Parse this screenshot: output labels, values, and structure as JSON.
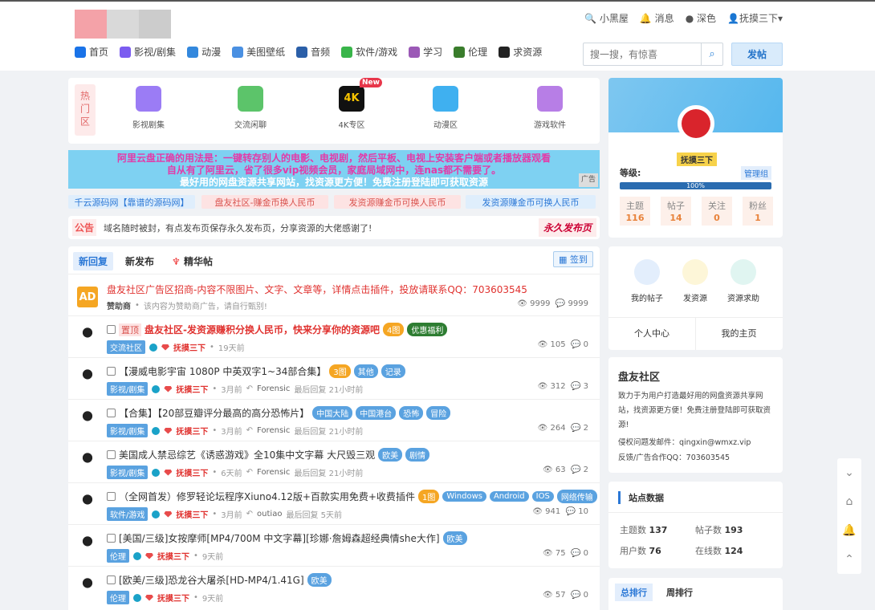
{
  "header": {
    "toplinks": [
      "小黑屋",
      "消息",
      "深色",
      "抚摸三下"
    ],
    "nav": [
      {
        "label": "首页",
        "color": "#1a73e8"
      },
      {
        "label": "影视/剧集",
        "color": "#7b5cf0"
      },
      {
        "label": "动漫",
        "color": "#3388dd"
      },
      {
        "label": "美图壁纸",
        "color": "#4a90e2"
      },
      {
        "label": "音频",
        "color": "#2b5fa8"
      },
      {
        "label": "软件/游戏",
        "color": "#39b54a"
      },
      {
        "label": "学习",
        "color": "#9b59b6"
      },
      {
        "label": "伦理",
        "color": "#3a7d2c"
      },
      {
        "label": "求资源",
        "color": "#222222"
      }
    ],
    "search_placeholder": "搜一搜，有惊喜",
    "post_label": "发帖"
  },
  "hot": {
    "label": "热门区",
    "items": [
      {
        "label": "影视剧集",
        "color": "#9b7cf5"
      },
      {
        "label": "交流闲聊",
        "color": "#5cc46a"
      },
      {
        "label": "4K专区",
        "color": "#f7c400"
      },
      {
        "label": "动漫区",
        "color": "#3fb0f0"
      },
      {
        "label": "游戏软件",
        "color": "#b77ee6"
      }
    ],
    "new_badge": "New",
    "fourk": "4K"
  },
  "banner": {
    "line1": "阿里云盘正确的用法是：一键转存别人的电影、电视剧，然后平板、电视上安装客户端或者播放器观看",
    "line2": "自从有了阿里云，省了很多vip视频会员，家庭局域网中，连nas都不需要了。",
    "line3": "最好用的网盘资源共享网站，找资源更方便！免费注册登陆即可获取资源",
    "ad": "广告"
  },
  "links": [
    {
      "label": "千云源码网【靠谱的源码网】",
      "bg": "#dfeefc",
      "color": "#2b78d6"
    },
    {
      "label": "盘友社区-赚金币换人民币",
      "bg": "#fde3e3",
      "color": "#d9534f"
    },
    {
      "label": "发资源赚金币可换人民币",
      "bg": "#fde3e3",
      "color": "#d9534f"
    },
    {
      "label": "发资源赚金币可换人民币",
      "bg": "#dfeefc",
      "color": "#2b78d6"
    }
  ],
  "notice": {
    "label": "公告",
    "text": "域名随时被封，有点发布页保存永久发布页，分享资源的大佬感谢了!",
    "right": "永久发布页"
  },
  "list": {
    "tabs": [
      "新回复",
      "新发布",
      "精华帖"
    ],
    "sign": "签到",
    "ad_row": {
      "badge": "AD",
      "title": "盘友社区广告区招商-内容不限图片、文字、文章等，详情点击插件，投放请联系QQ：703603545",
      "sponsor": "赞助商",
      "note": "该内容为赞助商广告，请自行甄别!",
      "views": "9999",
      "replies": "9999"
    },
    "rows": [
      {
        "prefix": "置顶",
        "title": "盘友社区-发资源赚积分换人民币，快来分享你的资源吧",
        "tags": [
          {
            "t": "4图",
            "c": "#ffffff",
            "b": "#f5a623"
          },
          {
            "t": "优惠福利",
            "c": "#fff",
            "b": "#2e7d32"
          }
        ],
        "cat": "交流社区",
        "author": "抚摸三下",
        "time": "19天前",
        "lastby": "",
        "lastreply": "",
        "views": "105",
        "replies": "0"
      },
      {
        "prefix": "",
        "title": "【漫威电影宇宙 1080P 中英双字1~34部合集】",
        "tags": [
          {
            "t": "3图",
            "c": "#fff",
            "b": "#f5a623"
          },
          {
            "t": "其他",
            "c": "#fff",
            "b": "#5aa2e0"
          },
          {
            "t": "记录",
            "c": "#fff",
            "b": "#5aa2e0"
          }
        ],
        "cat": "影视/剧集",
        "author": "抚摸三下",
        "time": "3月前",
        "lastby": "Forensic",
        "lastreply": "最后回复 21小时前",
        "views": "312",
        "replies": "3"
      },
      {
        "prefix": "",
        "title": "【合集】【20部豆瓣评分最高的高分恐怖片】",
        "tags": [
          {
            "t": "中国大陆",
            "c": "#fff",
            "b": "#5aa2e0"
          },
          {
            "t": "中国港台",
            "c": "#fff",
            "b": "#5aa2e0"
          },
          {
            "t": "恐怖",
            "c": "#fff",
            "b": "#5aa2e0"
          },
          {
            "t": "冒险",
            "c": "#fff",
            "b": "#5aa2e0"
          }
        ],
        "cat": "影视/剧集",
        "author": "抚摸三下",
        "time": "3月前",
        "lastby": "Forensic",
        "lastreply": "最后回复 21小时前",
        "views": "264",
        "replies": "2"
      },
      {
        "prefix": "",
        "title": "美国成人禁忌综艺《诱惑游戏》全10集中文字幕 大尺毁三观",
        "tags": [
          {
            "t": "欧美",
            "c": "#fff",
            "b": "#5aa2e0"
          },
          {
            "t": "剧情",
            "c": "#fff",
            "b": "#5aa2e0"
          }
        ],
        "cat": "影视/剧集",
        "author": "抚摸三下",
        "time": "6天前",
        "lastby": "Forensic",
        "lastreply": "最后回复 21小时前",
        "views": "63",
        "replies": "2"
      },
      {
        "prefix": "",
        "title": "（全网首发）修罗轻论坛程序Xiuno4.12版+百款实用免费+收费插件",
        "tags": [
          {
            "t": "1图",
            "c": "#fff",
            "b": "#f5a623"
          },
          {
            "t": "Windows",
            "c": "#fff",
            "b": "#5aa2e0"
          },
          {
            "t": "Android",
            "c": "#fff",
            "b": "#5aa2e0"
          },
          {
            "t": "IOS",
            "c": "#fff",
            "b": "#5aa2e0"
          },
          {
            "t": "网络传输",
            "c": "#fff",
            "b": "#5aa2e0"
          }
        ],
        "cat": "软件/游戏",
        "author": "抚摸三下",
        "time": "3月前",
        "lastby": "outiao",
        "lastreply": "最后回复 5天前",
        "views": "941",
        "replies": "10"
      },
      {
        "prefix": "",
        "title": "[美国/三级]女按摩师[MP4/700M 中文字幕][珍娜·詹姆森超经典情she大作]",
        "tags": [
          {
            "t": "欧美",
            "c": "#fff",
            "b": "#5aa2e0"
          }
        ],
        "cat": "伦理",
        "author": "抚摸三下",
        "time": "9天前",
        "lastby": "",
        "lastreply": "",
        "views": "75",
        "replies": "0"
      },
      {
        "prefix": "",
        "title": "[欧美/三级]恐龙谷大屠杀[HD-MP4/1.41G]",
        "tags": [
          {
            "t": "欧美",
            "c": "#fff",
            "b": "#5aa2e0"
          }
        ],
        "cat": "伦理",
        "author": "抚摸三下",
        "time": "9天前",
        "lastby": "",
        "lastreply": "",
        "views": "57",
        "replies": "0"
      }
    ]
  },
  "profile": {
    "name": "抚摸三下",
    "level_label": "等级:",
    "role": "管理组",
    "progress": "100%",
    "stats": [
      {
        "label": "主题",
        "value": "116"
      },
      {
        "label": "帖子",
        "value": "14"
      },
      {
        "label": "关注",
        "value": "0"
      },
      {
        "label": "粉丝",
        "value": "1"
      }
    ]
  },
  "quick": {
    "items": [
      "我的帖子",
      "发资源",
      "资源求助"
    ],
    "links": [
      "个人中心",
      "我的主页"
    ]
  },
  "about": {
    "title": "盘友社区",
    "desc": "致力于为用户打造最好用的网盘资源共享网站，找资源更方便！免费注册登陆即可获取资源!",
    "email": "侵权问题发邮件：qingxin@wmxz.vip",
    "qq": "反馈/广告合作QQ：703603545"
  },
  "site_stats": {
    "title": "站点数据",
    "items": [
      {
        "label": "主题数",
        "value": "137"
      },
      {
        "label": "帖子数",
        "value": "193"
      },
      {
        "label": "用户数",
        "value": "76"
      },
      {
        "label": "在线数",
        "value": "124"
      }
    ]
  },
  "rank": {
    "tabs": [
      "总排行",
      "周排行"
    ]
  }
}
